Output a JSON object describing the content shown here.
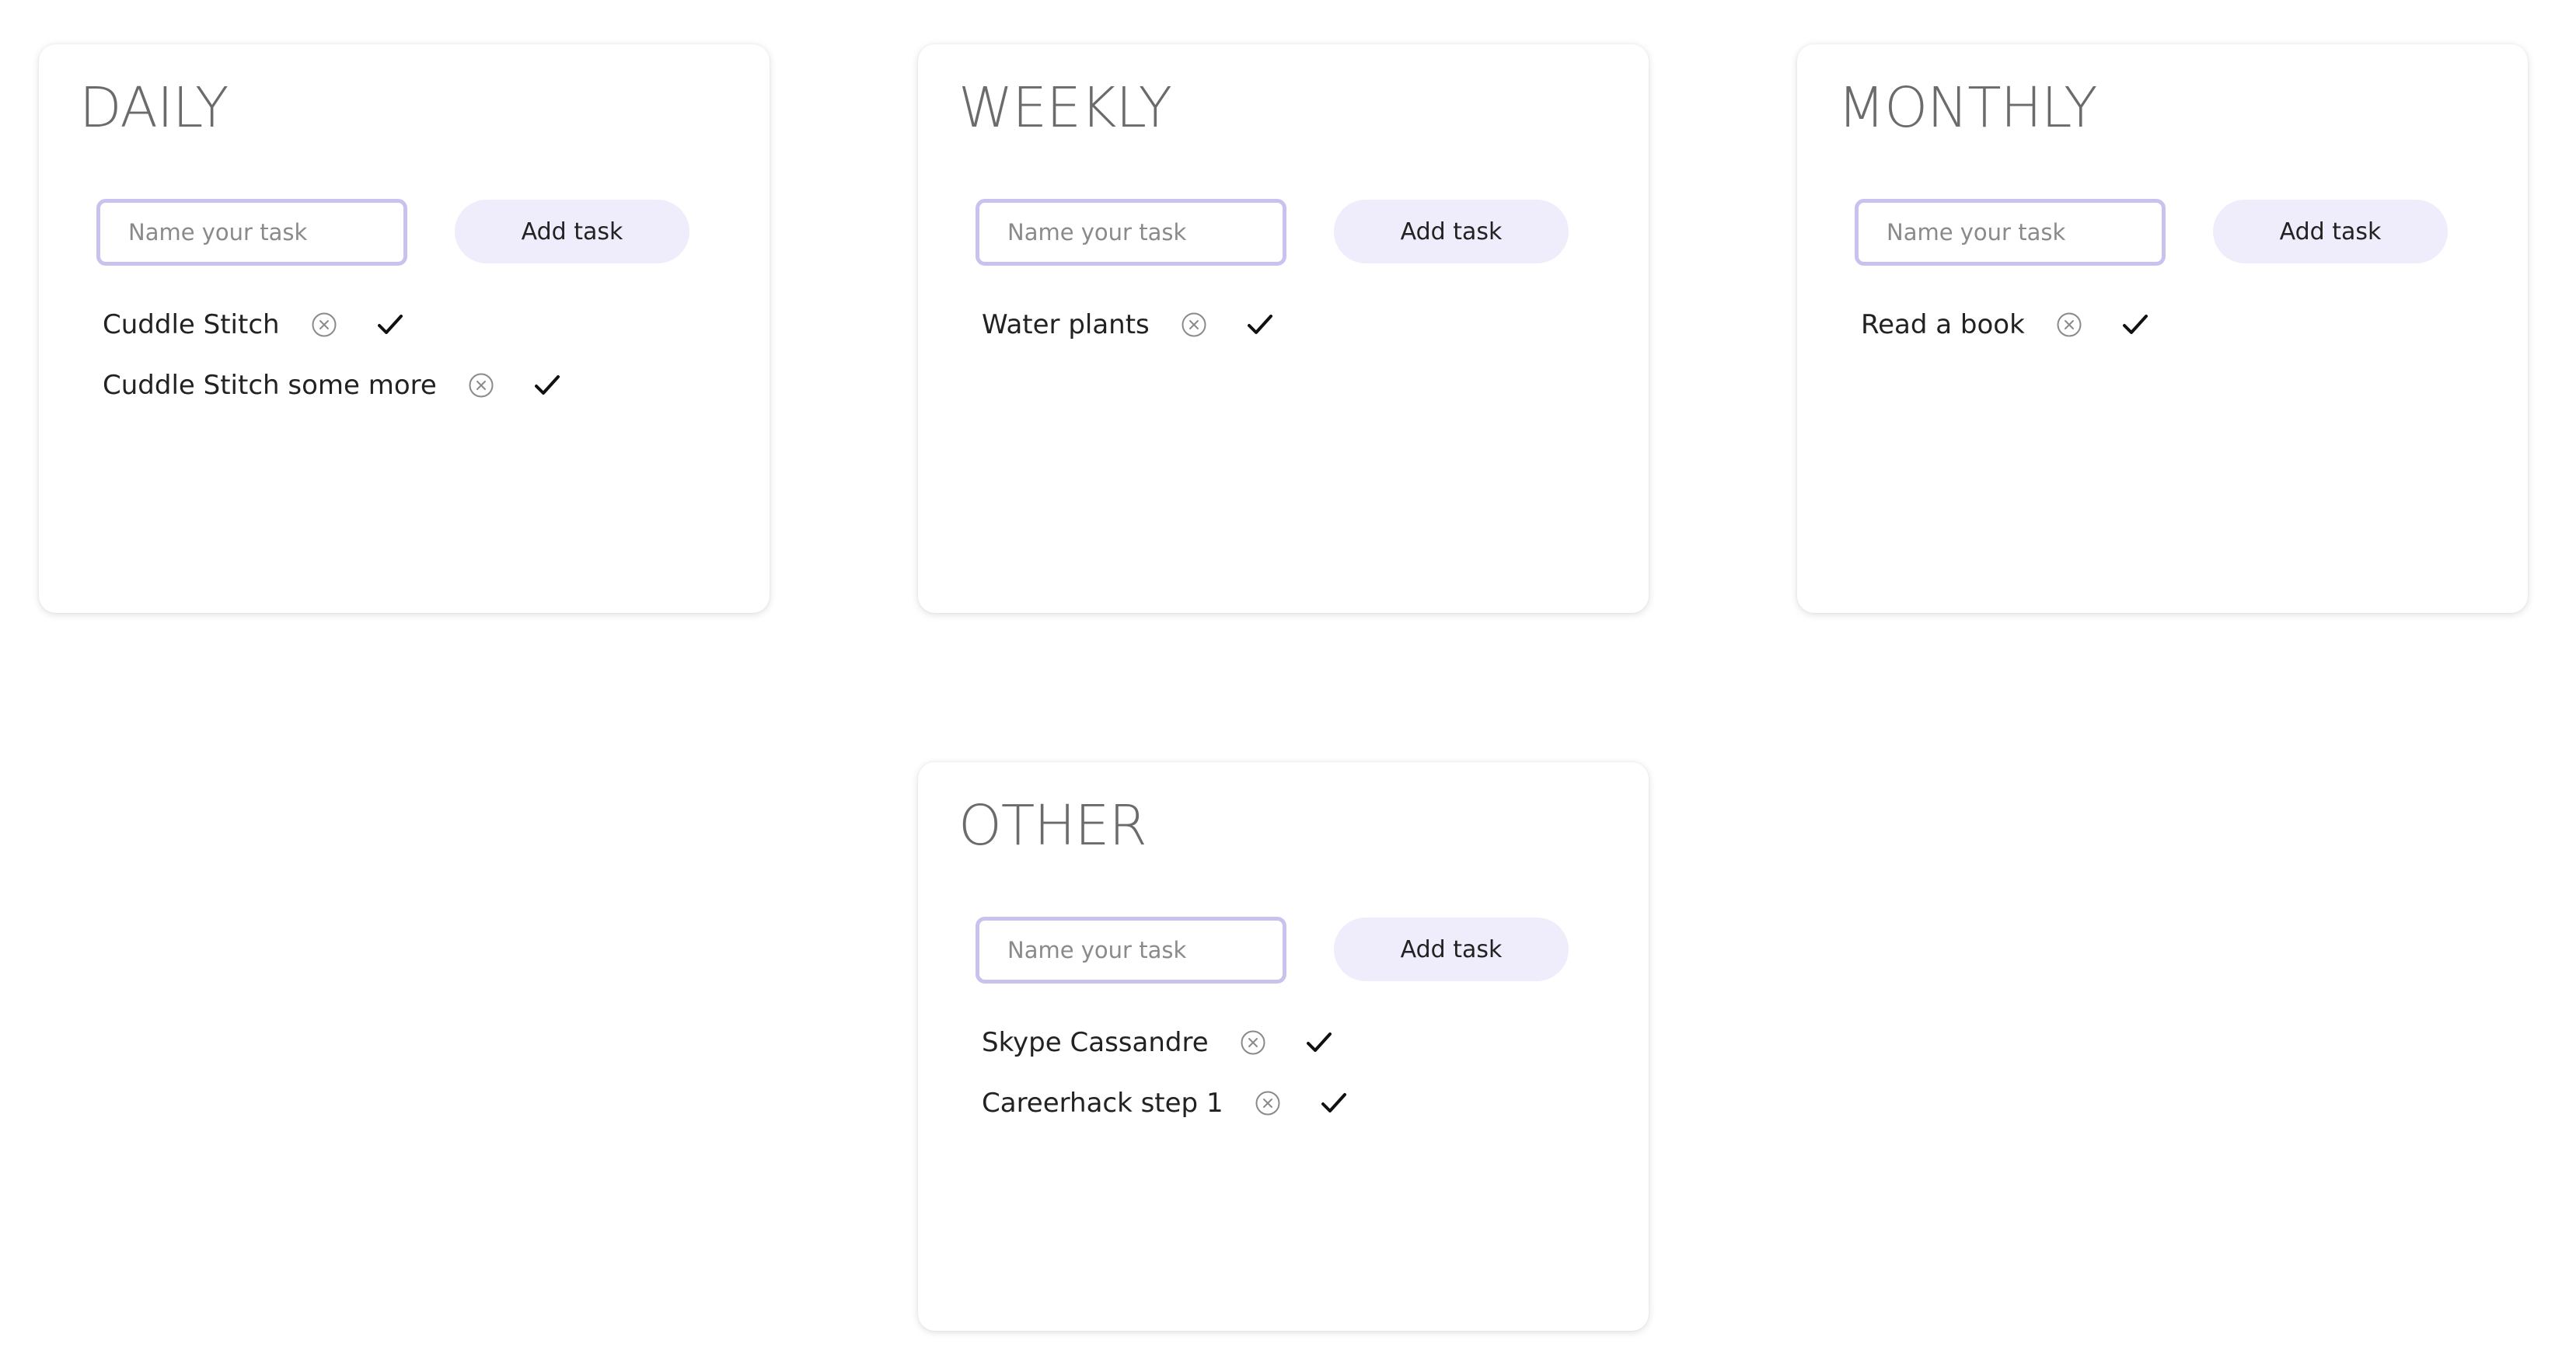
{
  "lists": [
    {
      "title": "DAILY",
      "input_placeholder": "Name your task",
      "add_label": "Add task",
      "tasks": [
        {
          "label": "Cuddle Stitch"
        },
        {
          "label": "Cuddle Stitch some more"
        }
      ]
    },
    {
      "title": "WEEKLY",
      "input_placeholder": "Name your task",
      "add_label": "Add task",
      "tasks": [
        {
          "label": "Water plants"
        }
      ]
    },
    {
      "title": "MONTHLY",
      "input_placeholder": "Name your task",
      "add_label": "Add task",
      "tasks": [
        {
          "label": "Read a book"
        }
      ]
    },
    {
      "title": "OTHER",
      "input_placeholder": "Name your task",
      "add_label": "Add task",
      "tasks": [
        {
          "label": "Skype Cassandre"
        },
        {
          "label": "Careerhack step 1"
        }
      ]
    }
  ],
  "icons": {
    "delete": "close-circle-icon",
    "complete": "checkmark-icon"
  },
  "colors": {
    "input_border": "#c9c2ee",
    "button_background": "#efedfb",
    "title_text": "#6b6b6b"
  }
}
